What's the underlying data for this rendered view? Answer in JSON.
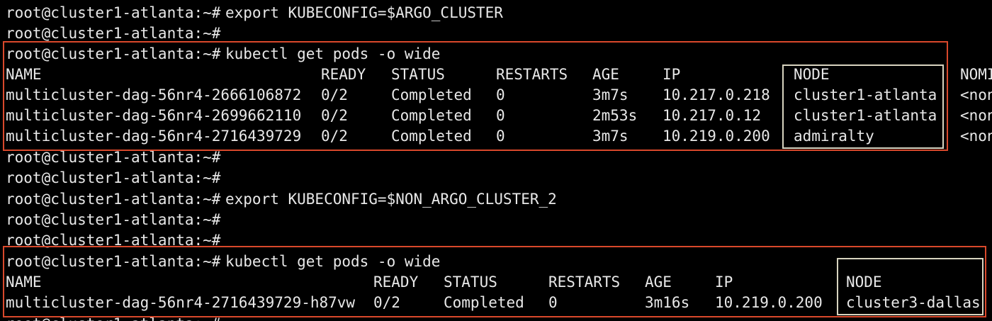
{
  "terminal": {
    "prompt": "root@cluster1-atlanta:~#",
    "commands": {
      "export_argo": "export KUBECONFIG=$ARGO_CLUSTER",
      "get_pods_1": "kubectl get pods -o wide",
      "export_non_argo": "export KUBECONFIG=$NON_ARGO_CLUSTER_2",
      "get_pods_2": "kubectl get pods -o wide"
    },
    "table1": {
      "headers": [
        "NAME",
        "READY",
        "STATUS",
        "RESTARTS",
        "AGE",
        "IP",
        "NODE",
        "NOMI"
      ],
      "rows": [
        [
          "multicluster-dag-56nr4-2666106872",
          "0/2",
          "Completed",
          "0",
          "3m7s",
          "10.217.0.218",
          "cluster1-atlanta",
          "<non"
        ],
        [
          "multicluster-dag-56nr4-2699662110",
          "0/2",
          "Completed",
          "0",
          "2m53s",
          "10.217.0.12",
          "cluster1-atlanta",
          "<non"
        ],
        [
          "multicluster-dag-56nr4-2716439729",
          "0/2",
          "Completed",
          "0",
          "3m7s",
          "10.219.0.200",
          "admiralty",
          "<non"
        ]
      ]
    },
    "table2": {
      "headers": [
        "NAME",
        "READY",
        "STATUS",
        "RESTARTS",
        "AGE",
        "IP",
        "NODE"
      ],
      "rows": [
        [
          "multicluster-dag-56nr4-2716439729-h87vw",
          "0/2",
          "Completed",
          "0",
          "3m16s",
          "10.219.0.200",
          "cluster3-dallas"
        ]
      ]
    },
    "trailing_partial": "root@cluster1-atlanta:~#"
  },
  "colors": {
    "background": "#000000",
    "text": "#e8e8e8",
    "highlight_box_red": "#d9482b",
    "highlight_box_white": "#d8d4c0"
  }
}
